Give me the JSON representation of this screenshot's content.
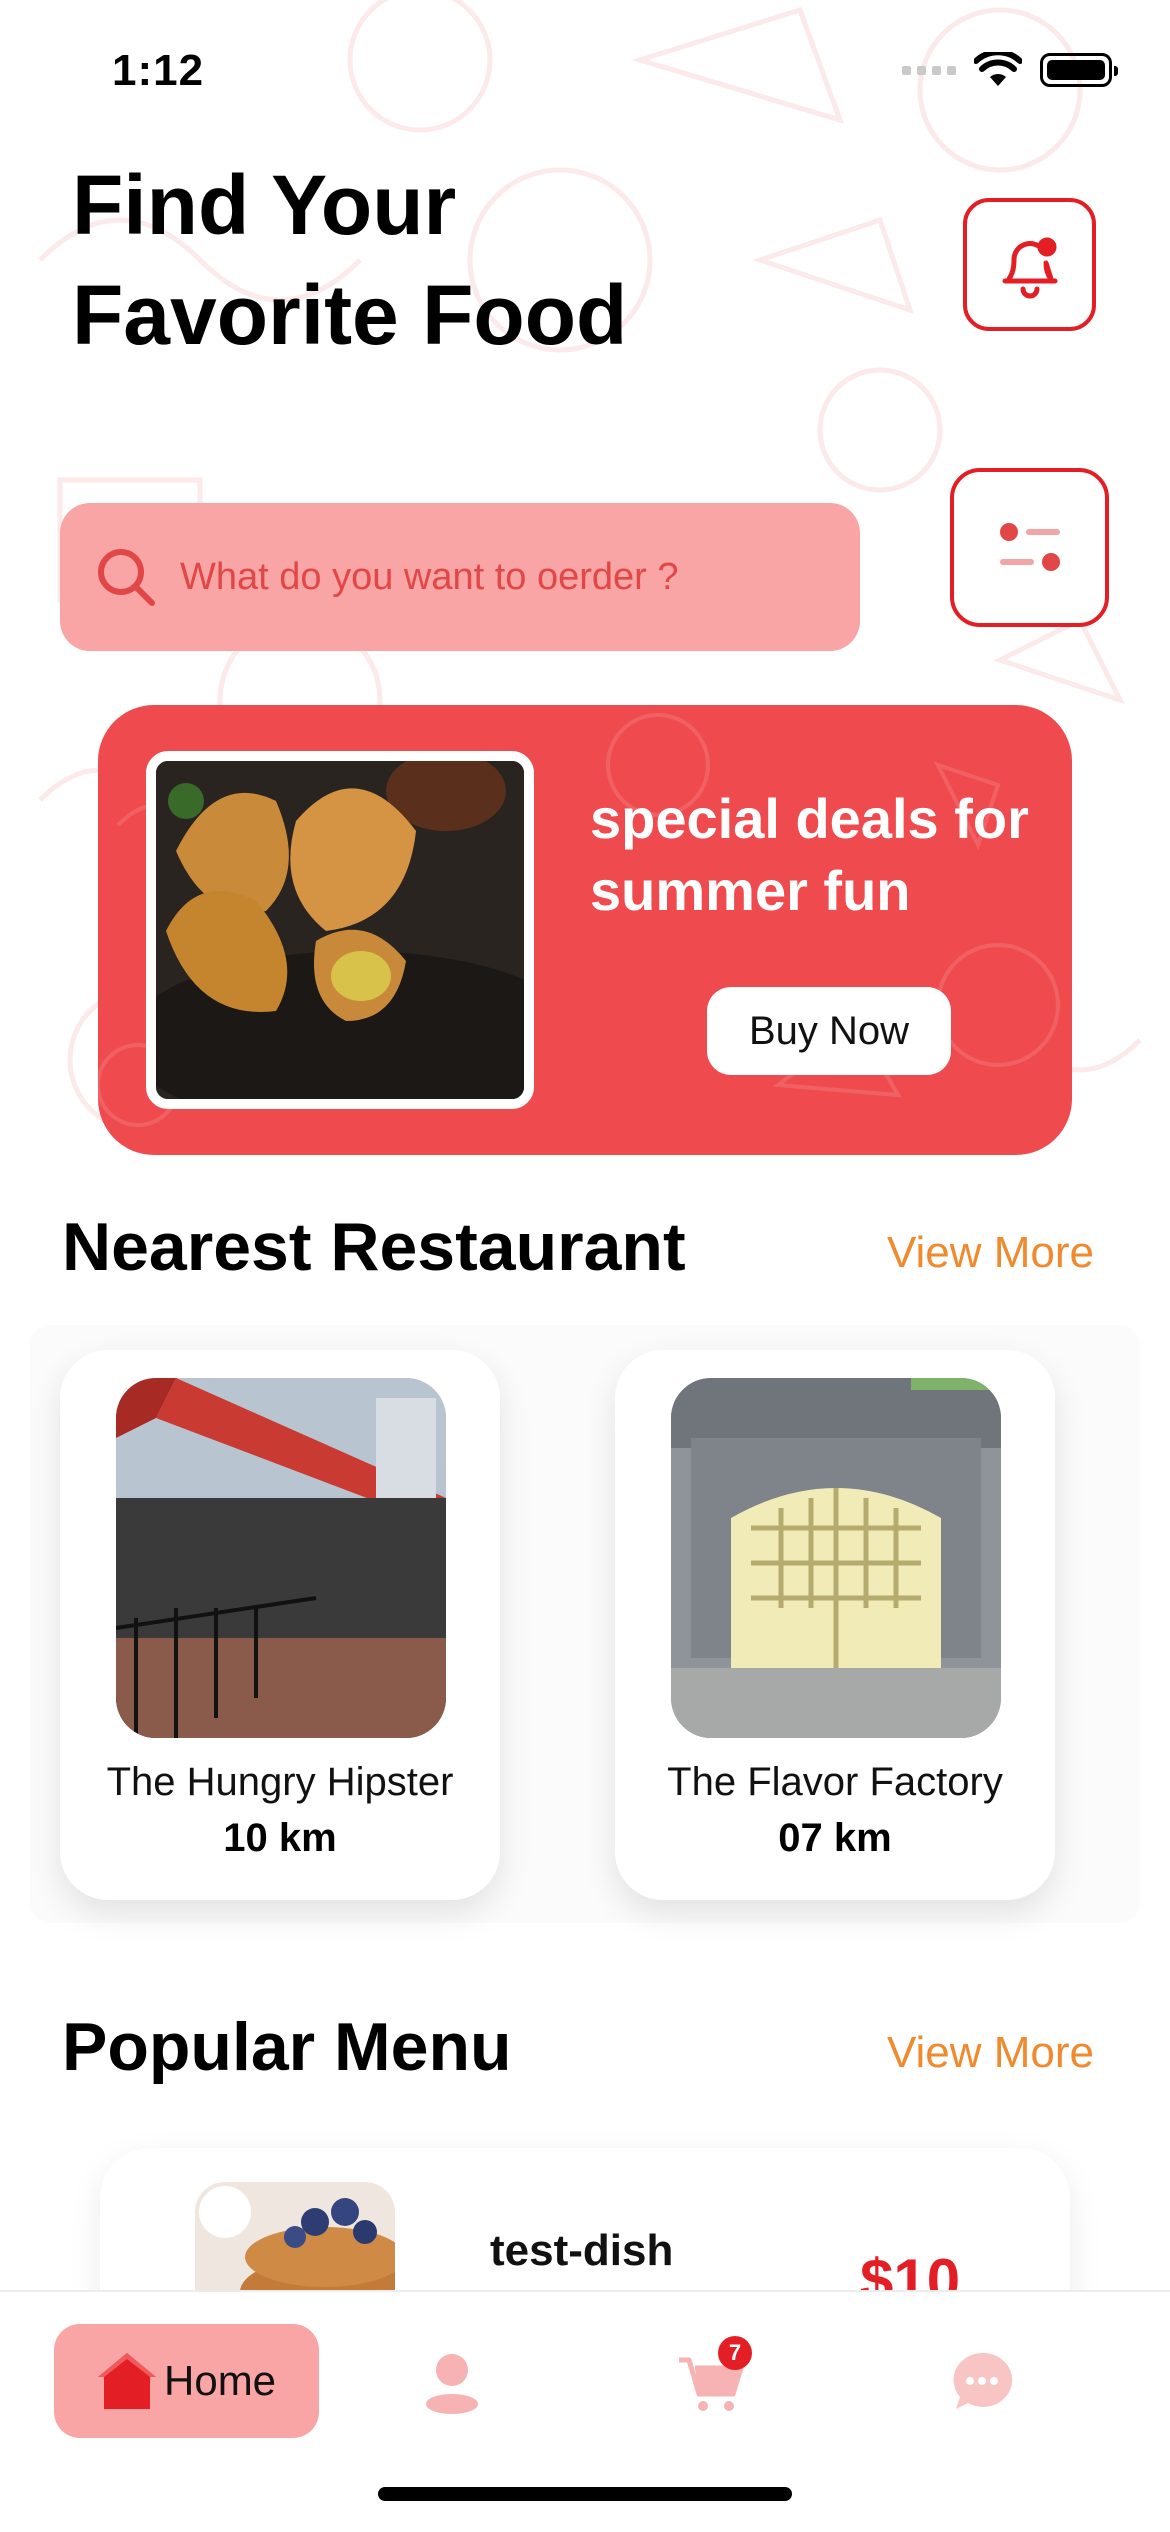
{
  "status_bar": {
    "time": "1:12"
  },
  "header": {
    "title_line1": "Find Your",
    "title_line2": "Favorite Food"
  },
  "search": {
    "placeholder": "What do you want to oerder ?"
  },
  "promo": {
    "title": "special deals for summer fun",
    "button_label": "Buy Now"
  },
  "nearest": {
    "title": "Nearest Restaurant",
    "view_more": "View More",
    "restaurants": [
      {
        "name": "The Hungry Hipster",
        "distance": "10 km"
      },
      {
        "name": "The Flavor Factory",
        "distance": "07 km"
      }
    ]
  },
  "popular": {
    "title": "Popular Menu",
    "view_more": "View More",
    "items": [
      {
        "name": "test-dish",
        "price": "$10"
      }
    ]
  },
  "tabbar": {
    "home_label": "Home",
    "cart_count": "7"
  },
  "colors": {
    "accent": "#e31e24",
    "promo_bg": "#ef4b4e",
    "pink": "#f9a5a5",
    "orange": "#f08a2e"
  },
  "icons": [
    "bell-icon",
    "filter-icon",
    "search-icon",
    "home-icon",
    "profile-icon",
    "cart-icon",
    "chat-icon"
  ]
}
